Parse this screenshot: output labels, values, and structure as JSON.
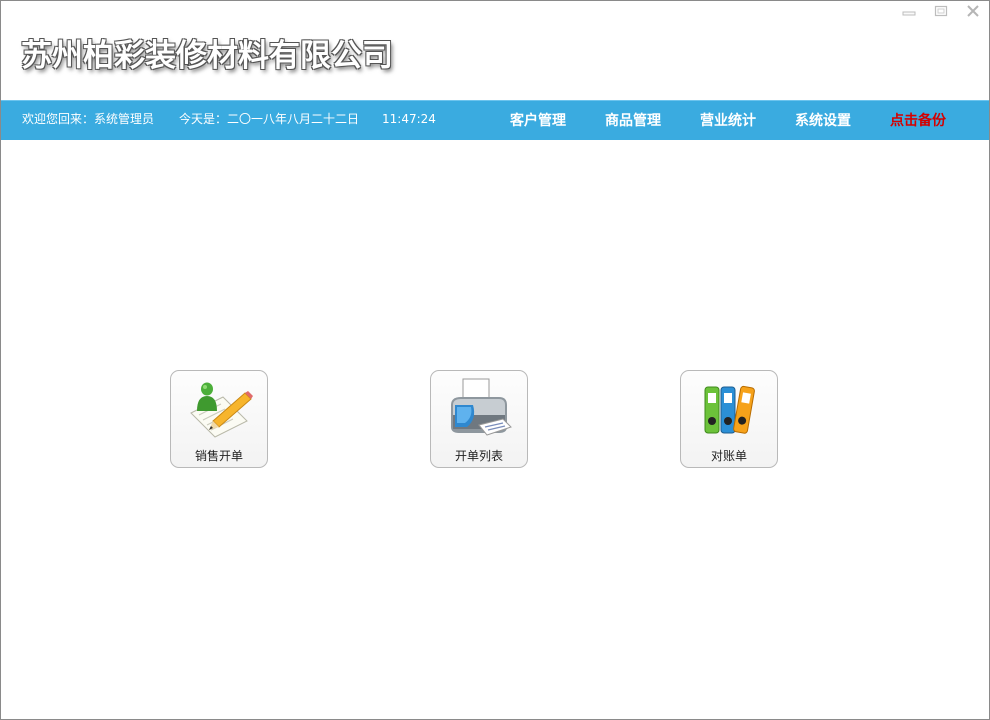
{
  "header": {
    "company_name": "苏州柏彩装修材料有限公司"
  },
  "window_controls": {
    "minimize_icon": "minimize-icon",
    "maximize_icon": "maximize-icon",
    "close_icon": "close-icon"
  },
  "navbar": {
    "welcome_text": "欢迎您回来：系统管理员",
    "date_text": "今天是：二〇一八年八月二十二日",
    "time_text": "11:47:24",
    "links": [
      {
        "label": "客户管理"
      },
      {
        "label": "商品管理"
      },
      {
        "label": "营业统计"
      },
      {
        "label": "系统设置"
      },
      {
        "label": "点击备份"
      }
    ]
  },
  "tiles": [
    {
      "label": "销售开单",
      "icon": "person-pencil-document-icon"
    },
    {
      "label": "开单列表",
      "icon": "printer-icon"
    },
    {
      "label": "对账单",
      "icon": "binders-icon"
    }
  ],
  "colors": {
    "navbar_bg": "#3aabe0",
    "backup_link": "#d40000",
    "nav_text": "#ffffff"
  }
}
